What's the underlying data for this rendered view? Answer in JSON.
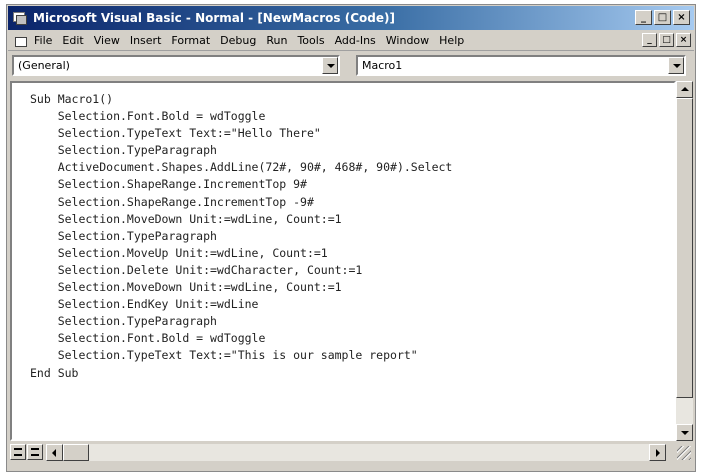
{
  "window": {
    "title": "Microsoft Visual Basic - Normal - [NewMacros (Code)]",
    "controls": [
      "_",
      "□",
      "×"
    ]
  },
  "menu": {
    "items": [
      "File",
      "Edit",
      "View",
      "Insert",
      "Format",
      "Debug",
      "Run",
      "Tools",
      "Add-Ins",
      "Window",
      "Help"
    ],
    "doc_controls": [
      "_",
      "□",
      "×"
    ]
  },
  "combos": {
    "object": "(General)",
    "procedure": "Macro1"
  },
  "code": [
    "Sub Macro1()",
    "    Selection.Font.Bold = wdToggle",
    "    Selection.TypeText Text:=\"Hello There\"",
    "    Selection.TypeParagraph",
    "    ActiveDocument.Shapes.AddLine(72#, 90#, 468#, 90#).Select",
    "    Selection.ShapeRange.IncrementTop 9#",
    "    Selection.ShapeRange.IncrementTop -9#",
    "    Selection.MoveDown Unit:=wdLine, Count:=1",
    "    Selection.TypeParagraph",
    "    Selection.MoveUp Unit:=wdLine, Count:=1",
    "    Selection.Delete Unit:=wdCharacter, Count:=1",
    "    Selection.MoveDown Unit:=wdLine, Count:=1",
    "    Selection.EndKey Unit:=wdLine",
    "    Selection.TypeParagraph",
    "    Selection.Font.Bold = wdToggle",
    "    Selection.TypeText Text:=\"This is our sample report\"",
    "End Sub"
  ],
  "colors": {
    "title_start": "#0a246a",
    "title_end": "#a6caf0",
    "chrome": "#d4d0c8"
  }
}
